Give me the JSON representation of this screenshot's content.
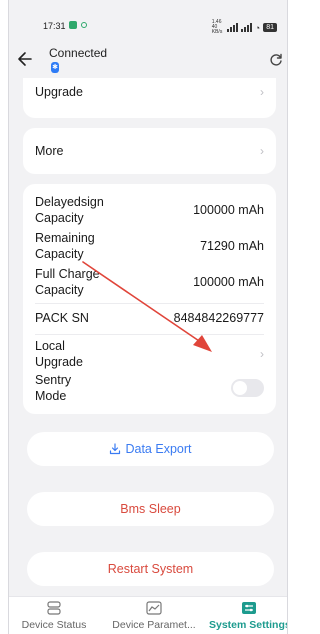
{
  "status_bar": {
    "time": "17:31",
    "net_speed": "1.46 40 KB/s",
    "battery": "81"
  },
  "header": {
    "title": "Connected",
    "bluetooth_icon": "bluetooth-icon",
    "back_icon": "arrow-left-icon",
    "refresh_icon": "refresh-icon"
  },
  "menu_top": {
    "upgrade_label": "Upgrade"
  },
  "menu_more": {
    "more_label": "More"
  },
  "info": {
    "delayedsign_label_1": "Delayedsign",
    "delayedsign_label_2": "Capacity",
    "delayedsign_value": "100000 mAh",
    "remaining_label_1": "Remaining",
    "remaining_label_2": "Capacity",
    "remaining_value": "71290 mAh",
    "fullcharge_label_1": "Full Charge",
    "fullcharge_label_2": "Capacity",
    "fullcharge_value": "100000 mAh",
    "packsn_label": "PACK SN",
    "packsn_value": "8484842269777",
    "local_upgrade_label_1": "Local",
    "local_upgrade_label_2": "Upgrade",
    "sentry_label_1": "Sentry",
    "sentry_label_2": "Mode",
    "sentry_on": false
  },
  "actions": {
    "export_label": "Data Export",
    "bms_sleep_label": "Bms Sleep",
    "restart_label": "Restart System"
  },
  "tabs": [
    {
      "label": "Device Status",
      "icon": "device-status-icon",
      "active": false
    },
    {
      "label": "Device Paramet...",
      "icon": "chart-icon",
      "active": false
    },
    {
      "label": "System Settings",
      "icon": "settings-icon",
      "active": true
    }
  ],
  "colors": {
    "accent_teal": "#1d9b8e",
    "export_blue": "#3a7bf2",
    "danger_red": "#d94a3e",
    "annotation_red": "#e0453a"
  }
}
